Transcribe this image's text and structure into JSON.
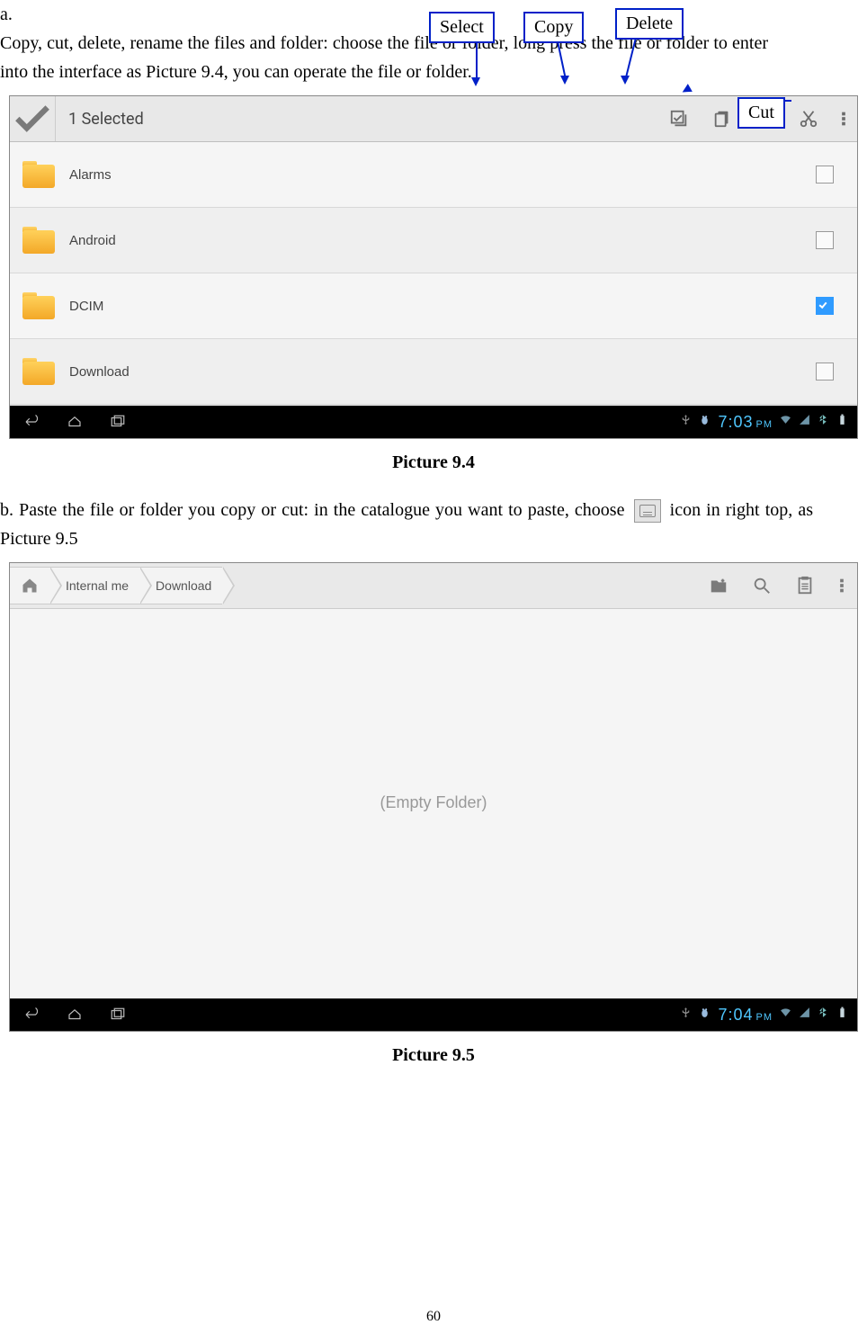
{
  "text": {
    "item_a_label": "a.",
    "item_a": "Copy, cut, delete, rename the files and folder: choose the file or folder, long press the file or folder to enter into the interface as Picture 9.4, you can operate the file or folder.",
    "caption94": "Picture 9.4",
    "item_b_pre": "b. Paste the file or folder you copy or cut: in the catalogue you want to paste, choose",
    "item_b_post": "icon in right top, as Picture 9.5",
    "caption95": "Picture 9.5",
    "page_number": "60"
  },
  "callouts": {
    "select": "Select",
    "copy": "Copy",
    "delete": "Delete",
    "cut": "Cut"
  },
  "fig94": {
    "title": "1 Selected",
    "rows": [
      {
        "name": "Alarms",
        "checked": false
      },
      {
        "name": "Android",
        "checked": false
      },
      {
        "name": "DCIM",
        "checked": true
      },
      {
        "name": "Download",
        "checked": false
      }
    ],
    "time": "7:03",
    "ampm": "PM"
  },
  "fig95": {
    "crumbs": [
      "Internal me",
      "Download"
    ],
    "empty": "(Empty Folder)",
    "time": "7:04",
    "ampm": "PM"
  }
}
